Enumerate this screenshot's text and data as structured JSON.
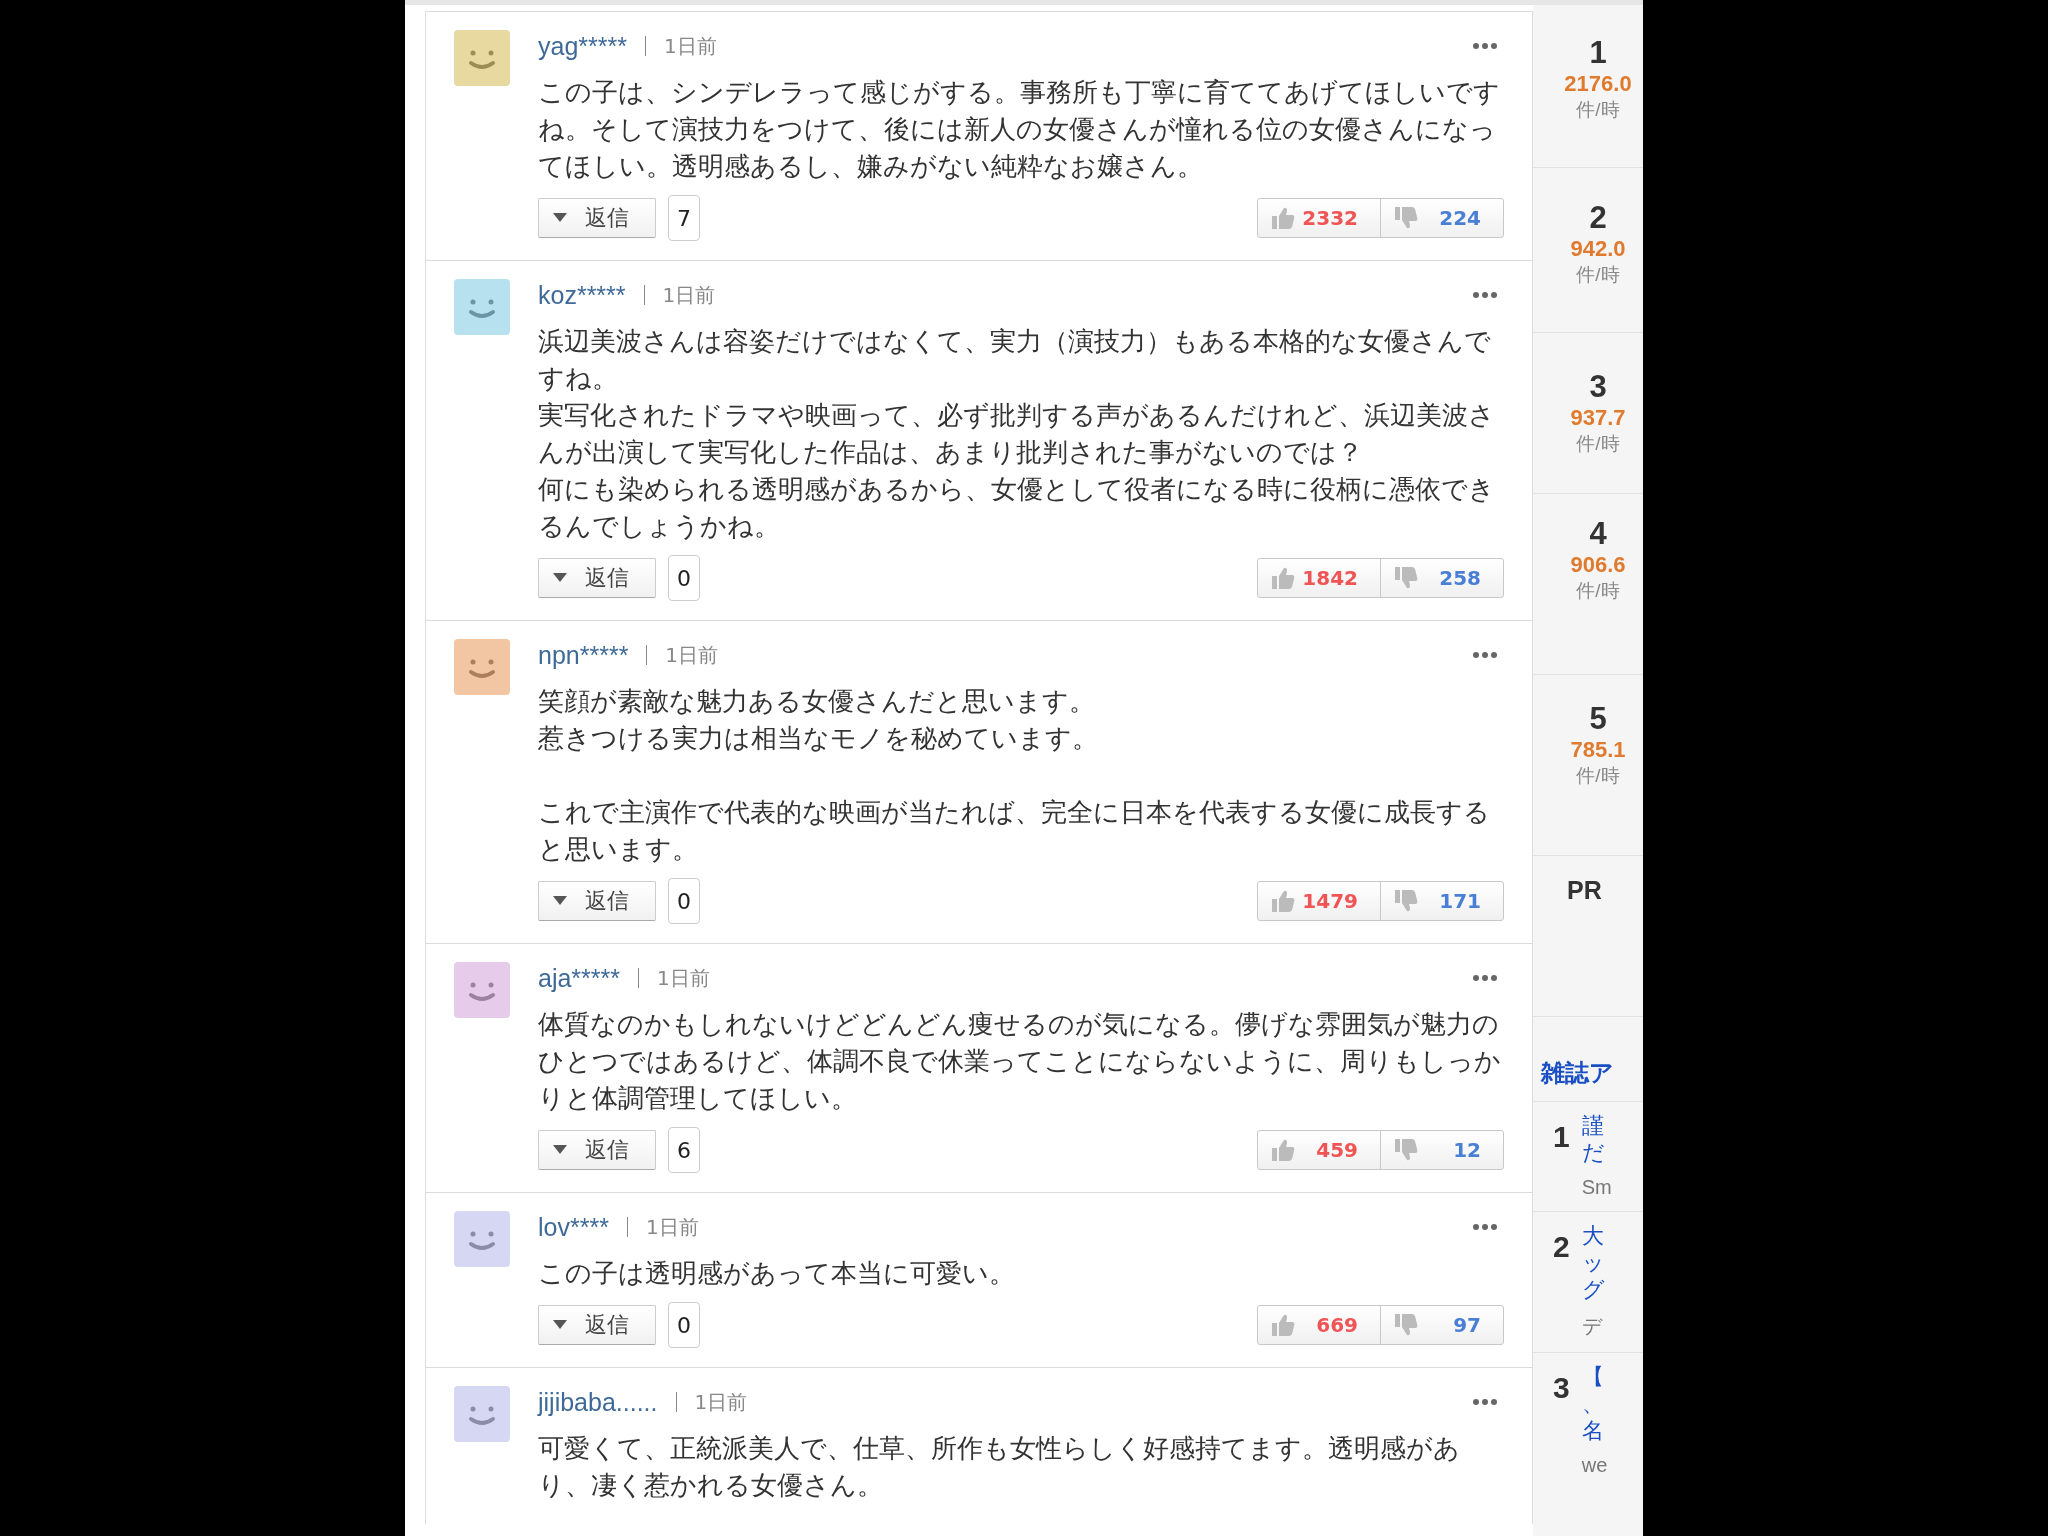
{
  "comments": [
    {
      "user": "yag*****",
      "time": "1日前",
      "color": "#e8d9a0",
      "blocks": [
        [
          "この子は、シンデレラって感じがする。事務所も丁寧に育ててあげてほしいですね。そして演技力をつけて、後には新人の女優さんが憧れる位の女優さんになってほしい。透明感あるし、嫌みがない純粋なお嬢さん。"
        ]
      ],
      "reply_label": "返信",
      "reply_count": "7",
      "likes": "2332",
      "dislikes": "224"
    },
    {
      "user": "koz*****",
      "time": "1日前",
      "color": "#b8e1f0",
      "blocks": [
        [
          "浜辺美波さんは容姿だけではなくて、実力（演技力）もある本格的な女優さんですね。",
          "実写化されたドラマや映画って、必ず批判する声があるんだけれど、浜辺美波さんが出演して実写化した作品は、あまり批判された事がないのでは？",
          "何にも染められる透明感があるから、女優として役者になる時に役柄に憑依できるんでしょうかね。"
        ]
      ],
      "reply_label": "返信",
      "reply_count": "0",
      "likes": "1842",
      "dislikes": "258"
    },
    {
      "user": "npn*****",
      "time": "1日前",
      "color": "#f2c6a2",
      "blocks": [
        [
          "笑顔が素敵な魅力ある女優さんだと思います。",
          "惹きつける実力は相当なモノを秘めています。"
        ],
        [
          "これで主演作で代表的な映画が当たれば、完全に日本を代表する女優に成長すると思います。"
        ]
      ],
      "reply_label": "返信",
      "reply_count": "0",
      "likes": "1479",
      "dislikes": "171"
    },
    {
      "user": "aja*****",
      "time": "1日前",
      "color": "#e7cbea",
      "blocks": [
        [
          "体質なのかもしれないけどどんどん痩せるのが気になる。儚げな雰囲気が魅力のひとつではあるけど、体調不良で休業ってことにならないように、周りもしっかりと体調管理してほしい。"
        ]
      ],
      "reply_label": "返信",
      "reply_count": "6",
      "likes": "459",
      "dislikes": "12"
    },
    {
      "user": "lov****",
      "time": "1日前",
      "color": "#d6d8f3",
      "blocks": [
        [
          "この子は透明感があって本当に可愛い。"
        ]
      ],
      "reply_label": "返信",
      "reply_count": "0",
      "likes": "669",
      "dislikes": "97"
    },
    {
      "user": "jijibaba......",
      "time": "1日前",
      "color": "#d6d8f3",
      "blocks": [
        [
          "可愛くて、正統派美人で、仕草、所作も女性らしく好感持てます。透明感があり、凄く惹かれる女優さん。"
        ]
      ]
    }
  ],
  "sidebar": {
    "ranking": [
      {
        "rank": "1",
        "value": "2176.0",
        "unit": "件/時"
      },
      {
        "rank": "2",
        "value": "942.0",
        "unit": "件/時"
      },
      {
        "rank": "3",
        "value": "937.7",
        "unit": "件/時"
      },
      {
        "rank": "4",
        "value": "906.6",
        "unit": "件/時"
      },
      {
        "rank": "5",
        "value": "785.1",
        "unit": "件/時"
      }
    ],
    "pr_label": "PR",
    "magazine": {
      "heading": "雑誌ア",
      "articles": [
        {
          "rank": "1",
          "title_lines": [
            "謹",
            "だ"
          ],
          "source": "Sm"
        },
        {
          "rank": "2",
          "title_lines": [
            "大",
            "ッ",
            "グ"
          ],
          "source": "デ"
        },
        {
          "rank": "3",
          "title_lines": [
            "【",
            "、",
            "名"
          ],
          "source": "we"
        }
      ]
    }
  }
}
